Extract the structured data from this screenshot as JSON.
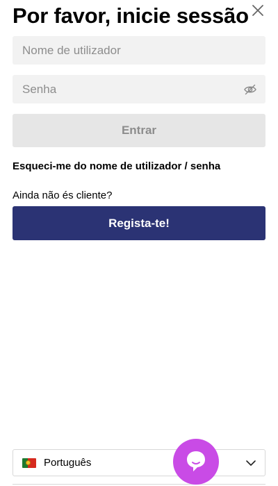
{
  "header": {
    "title": "Por favor, inicie sessão",
    "close_icon": "close-icon"
  },
  "login": {
    "username_placeholder": "Nome de utilizador",
    "username_value": "",
    "password_placeholder": "Senha",
    "password_value": "",
    "password_toggle_icon": "eye-off-icon",
    "submit_label": "Entrar",
    "submit_state": "disabled"
  },
  "forgot_link": "Esqueci-me do nome de utilizador / senha",
  "register": {
    "prompt": "Ainda não és cliente?",
    "button_label": "Regista-te!"
  },
  "language": {
    "selected": "Português",
    "flag_icon": "portugal-flag-icon",
    "dropdown_icon": "chevron-down-icon"
  },
  "chat": {
    "icon": "chat-bubble-icon"
  },
  "colors": {
    "primary": "#2b3374",
    "input_bg": "#f2f2f2",
    "disabled_btn": "#e6e6e6",
    "chat_accent": "#c94be6"
  }
}
